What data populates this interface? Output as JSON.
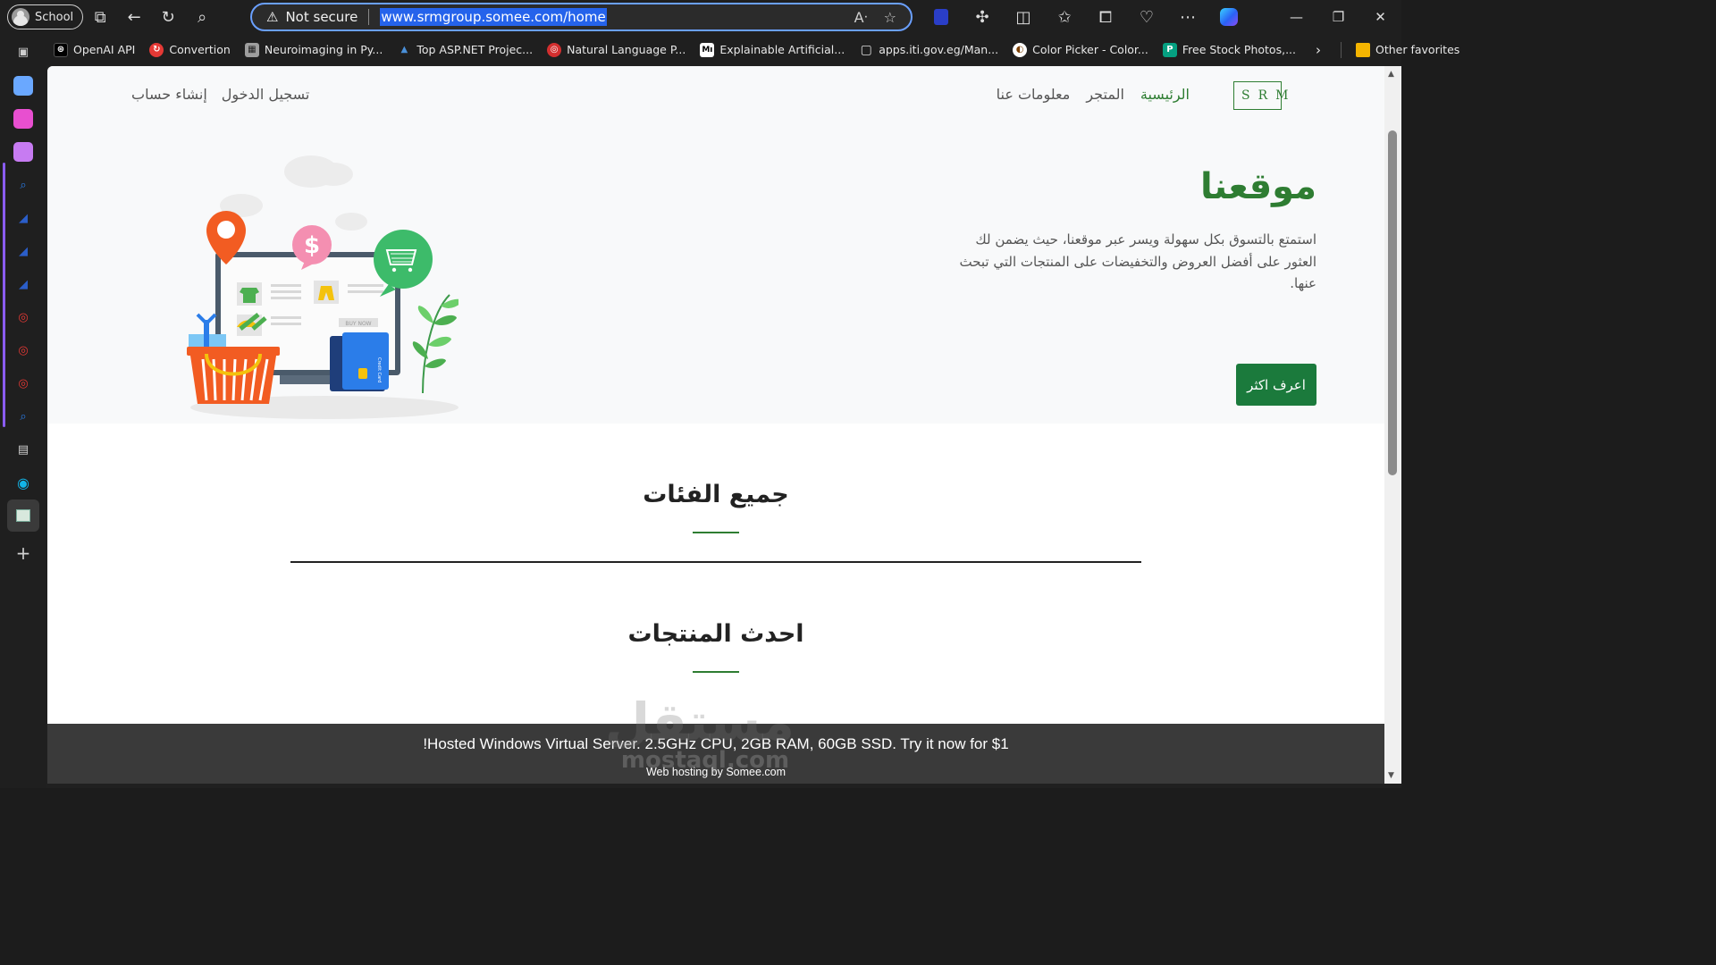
{
  "browser": {
    "profile_label": "School",
    "address": {
      "security_label": "Not secure",
      "url": "www.srmgroup.somee.com/home"
    },
    "bookmarks": [
      {
        "label": "OpenAI API",
        "color": "#000000",
        "glyph": "⊛"
      },
      {
        "label": "Convertion",
        "color": "#e53935",
        "glyph": "↻"
      },
      {
        "label": "Neuroimaging in Py...",
        "color": "#9e9e9e",
        "glyph": "▦"
      },
      {
        "label": "Top ASP.NET Projec...",
        "color": "#4a90d9",
        "glyph": "▲"
      },
      {
        "label": "Natural Language P...",
        "color": "#d32f2f",
        "glyph": "◎"
      },
      {
        "label": "Explainable Artificial...",
        "color": "#000000",
        "glyph": "Mı"
      },
      {
        "label": "apps.iti.gov.eg/Man...",
        "color": "transparent",
        "glyph": "▢"
      },
      {
        "label": "Color Picker - Color...",
        "color": "#ffffff",
        "glyph": "◐"
      },
      {
        "label": "Free Stock Photos,...",
        "color": "#05a081",
        "glyph": "P"
      }
    ],
    "other_favorites_label": "Other favorites"
  },
  "site": {
    "logo_text": "SRM",
    "nav": {
      "home": "الرئيسية",
      "store": "المتجر",
      "about": "معلومات عنا",
      "login": "تسجيل الدخول",
      "register": "إنشاء حساب"
    },
    "hero": {
      "title": "موقعنا",
      "text": "استمتع بالتسوق بكل سهولة ويسر عبر موقعنا، حيث يضمن لك العثور على أفضل العروض والتخفيضات على المنتجات التي تبحث عنها.",
      "button": "اعرف اكثر",
      "illustration_buy_label": "BUY NOW",
      "illustration_card_label": "Credit Card"
    },
    "sections": {
      "categories_title": "جميع الفئات",
      "latest_title": "احدث المنتجات"
    },
    "banner": {
      "line1": "!Hosted Windows Virtual Server. 2.5GHz CPU, 2GB RAM, 60GB SSD. Try it now for $1",
      "line2": "Web hosting by Somee.com"
    },
    "watermark": {
      "arabic": "مستقل",
      "latin": "mostaql.com"
    }
  },
  "colors": {
    "brand_green": "#2e7d32",
    "button_green": "#1b7a3c",
    "address_focus": "#6aa0ff"
  }
}
